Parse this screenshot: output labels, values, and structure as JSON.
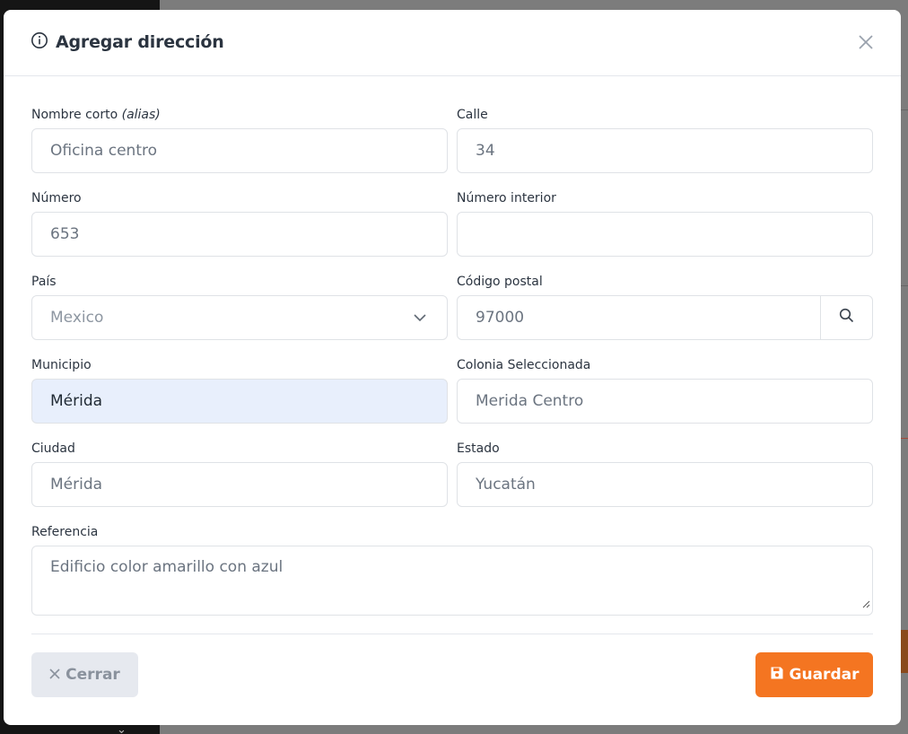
{
  "modal": {
    "title": "Agregar dirección",
    "title_icon": "info-circle-icon",
    "close_icon": "close-icon"
  },
  "form": {
    "alias": {
      "label_main": "Nombre corto",
      "label_hint": "(alias)",
      "value": "Oficina centro"
    },
    "calle": {
      "label": "Calle",
      "value": "34"
    },
    "numero": {
      "label": "Número",
      "value": "653"
    },
    "numero_interior": {
      "label": "Número interior",
      "value": ""
    },
    "pais": {
      "label": "País",
      "value": "Mexico",
      "icon": "chevron-down-icon"
    },
    "codigo_postal": {
      "label": "Código postal",
      "value": "97000",
      "icon": "search-icon"
    },
    "municipio": {
      "label": "Municipio",
      "value": "Mérida"
    },
    "colonia": {
      "label": "Colonia Seleccionada",
      "value": "Merida Centro"
    },
    "ciudad": {
      "label": "Ciudad",
      "value": "Mérida"
    },
    "estado": {
      "label": "Estado",
      "value": "Yucatán"
    },
    "referencia": {
      "label": "Referencia",
      "value": "Edificio color amarillo con azul"
    }
  },
  "footer": {
    "close_label": "Cerrar",
    "close_icon": "x-icon",
    "save_label": "Guardar",
    "save_icon": "floppy-disk-icon"
  },
  "colors": {
    "accent": "#f47521",
    "filled_input": "#e8effc",
    "close_button_bg": "#e6e9ef"
  }
}
